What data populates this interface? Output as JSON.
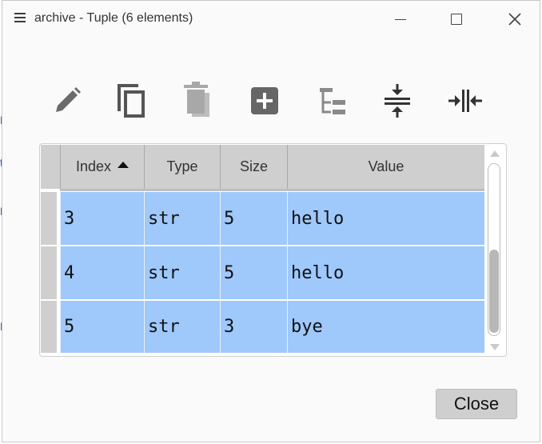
{
  "window": {
    "title": "archive - Tuple (6 elements)"
  },
  "toolbar": {
    "icons": [
      "edit-icon",
      "copy-icon",
      "delete-icon",
      "insert-icon",
      "tree-icon",
      "collapse-icon",
      "expand-icon"
    ]
  },
  "table": {
    "columns": [
      {
        "label": "Index",
        "sorted": "ascending"
      },
      {
        "label": "Type"
      },
      {
        "label": "Size"
      },
      {
        "label": "Value"
      }
    ],
    "rows": [
      {
        "index": "3",
        "type": "str",
        "size": "5",
        "value": "hello"
      },
      {
        "index": "4",
        "type": "str",
        "size": "5",
        "value": "hello"
      },
      {
        "index": "5",
        "type": "str",
        "size": "3",
        "value": "bye"
      }
    ],
    "scroll_position": 0.55
  },
  "footer": {
    "close_label": "Close"
  },
  "colors": {
    "selection": "#9fc8fb",
    "header": "#cfcfcf",
    "window_bg": "#fafafa"
  }
}
